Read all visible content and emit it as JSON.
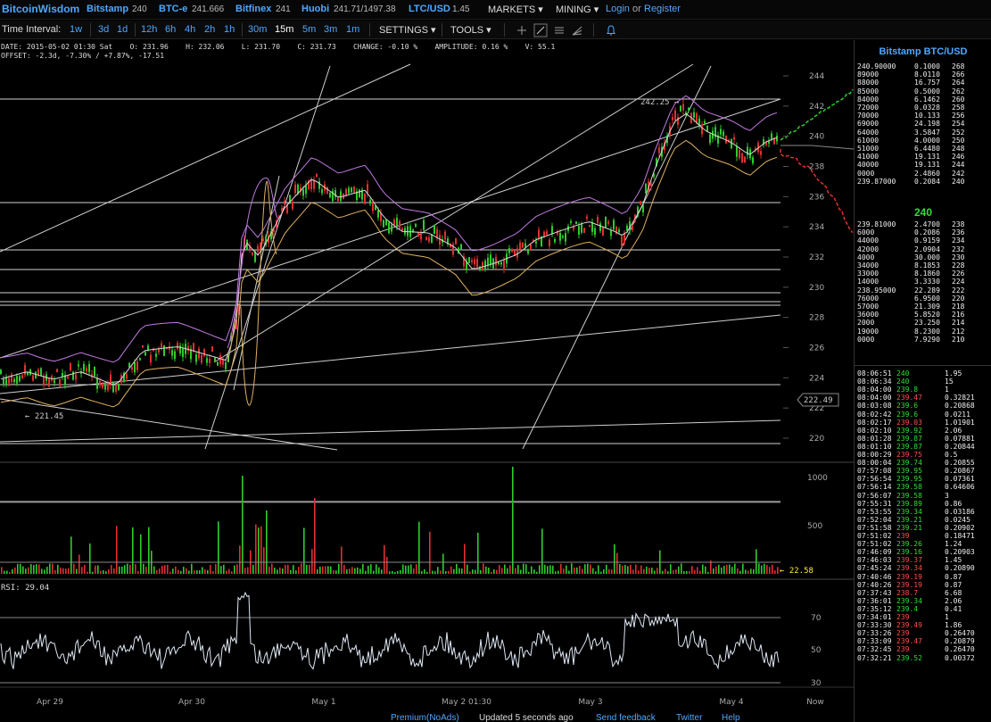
{
  "topbar": {
    "logo": "BitcoinWisdom",
    "markets": [
      {
        "name": "Bitstamp",
        "price": "240"
      },
      {
        "name": "BTC-e",
        "price": "241.666"
      },
      {
        "name": "Bitfinex",
        "price": "241"
      },
      {
        "name": "Huobi",
        "price": "241.71/1497.38"
      },
      {
        "name": "LTC/USD",
        "price": "1.45"
      }
    ],
    "menu_markets": "MARKETS ▾",
    "menu_mining": "MINING ▾",
    "login": "Login",
    "or": "or",
    "register": "Register"
  },
  "toolbar": {
    "label": "Time Interval:",
    "intervals": [
      "1w",
      "3d",
      "1d",
      "12h",
      "6h",
      "4h",
      "2h",
      "1h",
      "30m",
      "15m",
      "5m",
      "3m",
      "1m"
    ],
    "active_interval": "15m",
    "settings": "SETTINGS ▾",
    "tools": "TOOLS ▾"
  },
  "info": {
    "line1": "DATE: 2015-05-02 01:30 Sat    O: 231.96    H: 232.06    L: 231.70    C: 231.73    CHANGE: -0.10 %    AMPLITUDE: 0.16 %    V: 55.1",
    "line2": "OFFSET: -2.3d, -7.30% / +7.87%, -17.51"
  },
  "chart": {
    "price_ticks": [
      "244",
      "242",
      "240",
      "238",
      "236",
      "234",
      "232",
      "230",
      "228",
      "226",
      "224",
      "222",
      "220"
    ],
    "volume_ticks": [
      "1000",
      "500"
    ],
    "rsi_ticks": [
      "70",
      "50",
      "30"
    ],
    "date_labels": [
      "Apr 29",
      "Apr 30",
      "May 1",
      "May 2 01:30",
      "May 3",
      "May 4",
      "Now"
    ],
    "annotation_high": "242.25 →",
    "annotation_low": "← 221.45",
    "cursor_price": "222.49",
    "volume_value": "← 22.58",
    "rsi_label": "RSI: 29.04",
    "colors": {
      "up": "#2ecc2e",
      "down": "#e03030",
      "bollinger": "#c07ae0",
      "ma": "#e0b060",
      "line": "#d8d8d8"
    }
  },
  "panel": {
    "title": "Bitstamp BTC/USD",
    "last_price": "240",
    "asks": [
      [
        "240.90000",
        "0.1000",
        "268"
      ],
      [
        "89000",
        "8.0110",
        "266"
      ],
      [
        "88000",
        "16.757",
        "264"
      ],
      [
        "85000",
        "0.5000",
        "262"
      ],
      [
        "84000",
        "6.1462",
        "260"
      ],
      [
        "72000",
        "0.0328",
        "258"
      ],
      [
        "70000",
        "10.133",
        "256"
      ],
      [
        "69000",
        "24.198",
        "254"
      ],
      [
        "64000",
        "3.5847",
        "252"
      ],
      [
        "61000",
        "4.0000",
        "250"
      ],
      [
        "51000",
        "6.4480",
        "248"
      ],
      [
        "41000",
        "19.131",
        "246"
      ],
      [
        "40000",
        "19.131",
        "244"
      ],
      [
        "0000",
        "2.4860",
        "242"
      ],
      [
        "239.87000",
        "0.2084",
        "240"
      ]
    ],
    "bids": [
      [
        "239.81000",
        "2.4700",
        "238"
      ],
      [
        "6000",
        "0.2086",
        "236"
      ],
      [
        "44000",
        "0.9159",
        "234"
      ],
      [
        "42000",
        "2.0904",
        "232"
      ],
      [
        "4000",
        "30.000",
        "230"
      ],
      [
        "34000",
        "8.1853",
        "228"
      ],
      [
        "33000",
        "8.1860",
        "226"
      ],
      [
        "14000",
        "3.3330",
        "224"
      ],
      [
        "238.95000",
        "22.289",
        "222"
      ],
      [
        "76000",
        "6.9500",
        "220"
      ],
      [
        "57000",
        "21.309",
        "218"
      ],
      [
        "36000",
        "5.8520",
        "216"
      ],
      [
        "2000",
        "23.250",
        "214"
      ],
      [
        "19000",
        "8.2300",
        "212"
      ],
      [
        "0000",
        "7.9290",
        "210"
      ]
    ],
    "trades": [
      [
        "08:06:51",
        "240",
        "1.95",
        "up"
      ],
      [
        "08:06:34",
        "240",
        "15",
        "up"
      ],
      [
        "08:04:00",
        "239.8",
        "1",
        "up"
      ],
      [
        "08:04:00",
        "239.47",
        "0.32821",
        "down"
      ],
      [
        "08:03:08",
        "239.6",
        "0.20868",
        "up"
      ],
      [
        "08:02:42",
        "239.6",
        "0.0211",
        "up"
      ],
      [
        "08:02:17",
        "239.03",
        "1.01901",
        "down"
      ],
      [
        "08:02:10",
        "239.92",
        "2.06",
        "up"
      ],
      [
        "08:01:28",
        "239.87",
        "0.07881",
        "up"
      ],
      [
        "08:01:10",
        "239.87",
        "0.20844",
        "up"
      ],
      [
        "08:00:29",
        "239.75",
        "0.5",
        "down"
      ],
      [
        "08:00:04",
        "239.74",
        "0.20855",
        "up"
      ],
      [
        "07:57:08",
        "239.95",
        "0.20867",
        "up"
      ],
      [
        "07:56:54",
        "239.95",
        "0.07361",
        "up"
      ],
      [
        "07:56:14",
        "239.58",
        "0.64606",
        "up"
      ],
      [
        "07:56:07",
        "239.58",
        "3",
        "up"
      ],
      [
        "07:55:31",
        "239.89",
        "0.86",
        "up"
      ],
      [
        "07:53:55",
        "239.34",
        "0.03186",
        "up"
      ],
      [
        "07:52:04",
        "239.21",
        "0.0245",
        "up"
      ],
      [
        "07:51:58",
        "239.21",
        "0.20902",
        "up"
      ],
      [
        "07:51:02",
        "239",
        "0.18471",
        "down"
      ],
      [
        "07:51:02",
        "239.26",
        "1.24",
        "up"
      ],
      [
        "07:46:09",
        "239.16",
        "0.20903",
        "up"
      ],
      [
        "07:46:03",
        "239.37",
        "1.45",
        "down"
      ],
      [
        "07:45:24",
        "239.34",
        "0.20890",
        "down"
      ],
      [
        "07:40:46",
        "239.19",
        "0.87",
        "down"
      ],
      [
        "07:40:26",
        "239.19",
        "0.87",
        "down"
      ],
      [
        "07:37:43",
        "238.7",
        "6.68",
        "down"
      ],
      [
        "07:36:01",
        "239.34",
        "2.06",
        "up"
      ],
      [
        "07:35:12",
        "239.4",
        "0.41",
        "up"
      ],
      [
        "07:34:01",
        "239",
        "1",
        "down"
      ],
      [
        "07:33:30",
        "239.49",
        "1.86",
        "down"
      ],
      [
        "07:33:26",
        "239",
        "0.26470",
        "down"
      ],
      [
        "07:33:09",
        "239.47",
        "0.20879",
        "down"
      ],
      [
        "07:32:45",
        "239",
        "0.26470",
        "down"
      ],
      [
        "07:32:21",
        "239.52",
        "0.00372",
        "up"
      ]
    ]
  },
  "footer": {
    "premium": "Premium(NoAds)",
    "updated": "Updated 5 seconds ago",
    "feedback": "Send feedback",
    "twitter": "Twitter",
    "help": "Help"
  }
}
